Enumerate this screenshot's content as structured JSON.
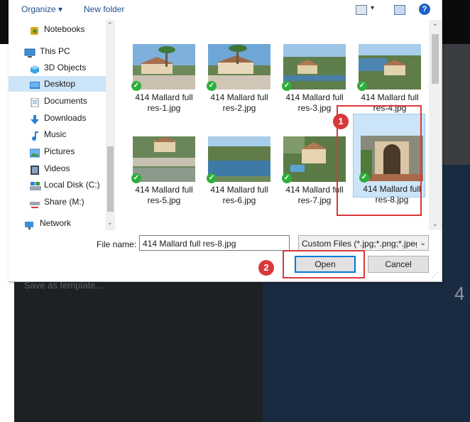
{
  "background": {
    "ghost_text": "Save as template...",
    "ghost_digit": "4"
  },
  "toolbar": {
    "organize_label": "Organize ▾",
    "new_folder_label": "New folder",
    "view_caret": "▾",
    "help_label": "?"
  },
  "nav": {
    "items": [
      {
        "label": "Notebooks",
        "icon": "notebook-icon"
      },
      {
        "label": "This PC",
        "icon": "computer-icon"
      },
      {
        "label": "3D Objects",
        "icon": "cube-icon"
      },
      {
        "label": "Desktop",
        "icon": "desktop-icon"
      },
      {
        "label": "Documents",
        "icon": "documents-icon"
      },
      {
        "label": "Downloads",
        "icon": "download-arrow-icon"
      },
      {
        "label": "Music",
        "icon": "music-note-icon"
      },
      {
        "label": "Pictures",
        "icon": "pictures-icon"
      },
      {
        "label": "Videos",
        "icon": "video-film-icon"
      },
      {
        "label": "Local Disk (C:)",
        "icon": "local-disk-icon"
      },
      {
        "label": "Share (M:)",
        "icon": "network-drive-icon"
      },
      {
        "label": "Network",
        "icon": "network-icon"
      }
    ],
    "selected": "Desktop",
    "scroll_up": "⌃",
    "scroll_down": "⌄"
  },
  "files": [
    {
      "line1": "414 Mallard full",
      "line2": "res-1.jpg"
    },
    {
      "line1": "414 Mallard full",
      "line2": "res-2.jpg"
    },
    {
      "line1": "414 Mallard full",
      "line2": "res-3.jpg"
    },
    {
      "line1": "414 Mallard full",
      "line2": "res-4.jpg"
    },
    {
      "line1": "414 Mallard full",
      "line2": "res-5.jpg"
    },
    {
      "line1": "414 Mallard full",
      "line2": "res-6.jpg"
    },
    {
      "line1": "414 Mallard full",
      "line2": "res-7.jpg"
    },
    {
      "line1": "414 Mallard full",
      "line2": "res-8.jpg"
    }
  ],
  "selected_file": "414 Mallard full res-8.jpg",
  "file_name": {
    "label": "File name:",
    "value": "414 Mallard full res-8.jpg",
    "caret": "⌄"
  },
  "filter": {
    "value": "Custom Files (*.jpg;*.png;*.jpeg",
    "caret": "⌄"
  },
  "buttons": {
    "open": "Open",
    "cancel": "Cancel"
  },
  "markers": {
    "one": "1",
    "two": "2"
  },
  "colors": {
    "accent_blue": "#0078d7",
    "selection": "#cce4f7",
    "highlight_red": "#d9383a",
    "check_green": "#2fae3c"
  }
}
